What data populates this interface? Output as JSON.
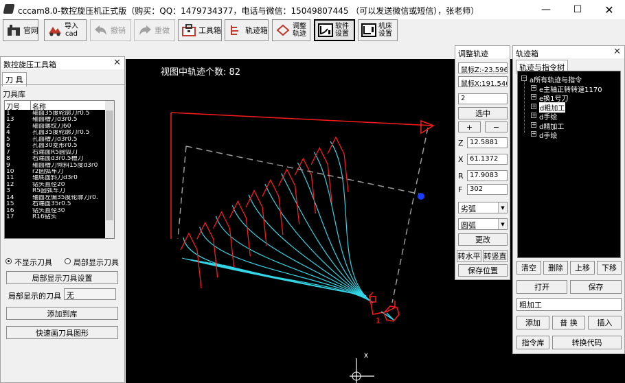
{
  "window": {
    "title": "cccam8.0-数控旋压机正式版（购买：QQ：1479734377，电话与微信：15049807445 （可以发送微信或短信），张老师）"
  },
  "toolbar": {
    "official": "官网",
    "import_l1": "导入",
    "import_l2": "cad",
    "undo": "撤销",
    "redo": "重做",
    "toolbox": "工具箱",
    "trackbox": "轨迹箱",
    "adjust_l1": "调整",
    "adjust_l2": "轨迹",
    "software_l1": "软件",
    "software_l2": "设置",
    "machine_l1": "机床",
    "machine_l2": "设置"
  },
  "canvas": {
    "count_text": "视图中轨迹个数: 82",
    "point_label": "1",
    "axis_label": "x",
    "colors": {
      "path_red": "#ff1a1a",
      "path_cyan": "#33d6e6",
      "dash": "#9a9a9a",
      "point": "#1a3cff"
    }
  },
  "toolbox": {
    "title": "数控旋压工具箱",
    "tab": "刀 具",
    "library_label": "刀具库",
    "col_no": "刀号",
    "col_name": "名称",
    "tools": [
      {
        "no": "1",
        "name": "轴面35度轮廓刀r0.5"
      },
      {
        "no": "13",
        "name": "轴面槽刀d3r0.5"
      },
      {
        "no": "2",
        "name": "轴面螺纹刀60"
      },
      {
        "no": "4",
        "name": "孔面35度轮廓刀r0.5"
      },
      {
        "no": "5",
        "name": "孔面槽刀d3r0.5"
      },
      {
        "no": "6",
        "name": "孔面30菱形r0.5"
      },
      {
        "no": "7",
        "name": "右端面R5圆弧刀"
      },
      {
        "no": "8",
        "name": "右端面d3r0.5槽刀"
      },
      {
        "no": "9",
        "name": "轴面槽刀倾斜15度d3r0"
      },
      {
        "no": "10",
        "name": "r2圆弧车刀"
      },
      {
        "no": "11",
        "name": "轴底面斜刀d3r0"
      },
      {
        "no": "12",
        "name": "钻头直径20"
      },
      {
        "no": "3",
        "name": "R5圆弧车刀"
      },
      {
        "no": "14",
        "name": "轴面左偏35度轮廓刀r0."
      },
      {
        "no": "15",
        "name": "右端面35r0.5"
      },
      {
        "no": "16",
        "name": "钻头直径30"
      },
      {
        "no": "17",
        "name": "R16钻头"
      }
    ],
    "radio_hide": "不显示刀具",
    "radio_local": "局部显示刀具",
    "local_settings_btn": "局部显示刀具设置",
    "local_tool_label": "局部显示的刀具",
    "local_tool_value": "无",
    "add_btn": "添加到库",
    "quick_draw_btn": "快速画刀具图形"
  },
  "adjust": {
    "title": "调整轨迹",
    "coord_z": "鼠标Z:-23.596",
    "coord_x": "鼠标X:191.546",
    "index_value": "2",
    "select_btn": "选中",
    "plus": "+",
    "minus": "−",
    "z_label": "Z",
    "z_value": "12.5881",
    "x_label": "X",
    "x_value": "61.1372",
    "r_label": "R",
    "r_value": "17.9083",
    "f_label": "F",
    "f_value": "302",
    "arc_type": "劣弧",
    "shape": "圆弧",
    "change_btn": "更改",
    "to_horizontal": "转水平",
    "to_vertical": "转竖直",
    "save_pos": "保存位置"
  },
  "trackbox": {
    "title": "轨迹箱",
    "tab": "轨迹与指令树",
    "tree": [
      {
        "text": "a所有轨迹与指令",
        "level": 0,
        "box": "−"
      },
      {
        "text": "e主轴正转转速1170",
        "level": 1,
        "box": "+"
      },
      {
        "text": "e换1号刀",
        "level": 1,
        "box": "+"
      },
      {
        "text": "d粗加工",
        "level": 1,
        "box": "+",
        "selected": true
      },
      {
        "text": "d手绘",
        "level": 1,
        "box": "+"
      },
      {
        "text": "d精加工",
        "level": 1,
        "box": "+"
      },
      {
        "text": "d手绘",
        "level": 1,
        "box": "+"
      }
    ],
    "clear": "清空",
    "delete": "删除",
    "up": "上移",
    "down": "下移",
    "open": "打开",
    "save": "保存",
    "name_value": "粗加工",
    "add": "添加",
    "replace": "普 换",
    "insert": "插入",
    "library": "指令库",
    "convert": "转换代码"
  }
}
